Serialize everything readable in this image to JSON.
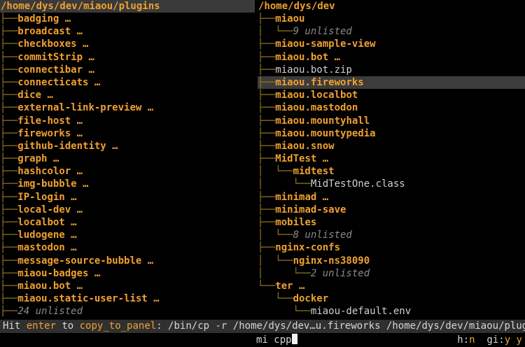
{
  "left_panel": {
    "path": "/home/dys/dev/miaou/plugins",
    "items": [
      {
        "name": "badging …",
        "kind": "dir"
      },
      {
        "name": "broadcast …",
        "kind": "dir"
      },
      {
        "name": "checkboxes …",
        "kind": "dir"
      },
      {
        "name": "commitStrip …",
        "kind": "dir"
      },
      {
        "name": "connectibar …",
        "kind": "dir"
      },
      {
        "name": "connecticats …",
        "kind": "dir"
      },
      {
        "name": "dice …",
        "kind": "dir"
      },
      {
        "name": "external-link-preview …",
        "kind": "dir"
      },
      {
        "name": "file-host …",
        "kind": "dir"
      },
      {
        "name": "fireworks …",
        "kind": "dir"
      },
      {
        "name": "github-identity …",
        "kind": "dir"
      },
      {
        "name": "graph …",
        "kind": "dir"
      },
      {
        "name": "hashcolor …",
        "kind": "dir"
      },
      {
        "name": "img-bubble …",
        "kind": "dir"
      },
      {
        "name": "IP-login …",
        "kind": "dir"
      },
      {
        "name": "local-dev …",
        "kind": "dir"
      },
      {
        "name": "localbot …",
        "kind": "dir"
      },
      {
        "name": "ludogene …",
        "kind": "dir"
      },
      {
        "name": "mastodon …",
        "kind": "dir"
      },
      {
        "name": "message-source-bubble …",
        "kind": "dir"
      },
      {
        "name": "miaou-badges …",
        "kind": "dir"
      },
      {
        "name": "miaou.bot …",
        "kind": "dir"
      },
      {
        "name": "miaou.static-user-list …",
        "kind": "dir"
      },
      {
        "name": "24 unlisted",
        "kind": "note"
      }
    ]
  },
  "right_panel": {
    "path": "/home/dys/dev",
    "items": [
      {
        "prefix": "├──",
        "name": "miaou",
        "kind": "dir"
      },
      {
        "prefix": "│  └──",
        "name": "9 unlisted",
        "kind": "note"
      },
      {
        "prefix": "├──",
        "name": "miaou-sample-view",
        "kind": "dir"
      },
      {
        "prefix": "├──",
        "name": "miaou.bot …",
        "kind": "dir"
      },
      {
        "prefix": "├──",
        "name": "miaou.bot.zip",
        "kind": "file"
      },
      {
        "prefix": "├──",
        "name": "miaou.fireworks",
        "kind": "dir",
        "selected": true
      },
      {
        "prefix": "├──",
        "name": "miaou.localbot",
        "kind": "dir"
      },
      {
        "prefix": "├──",
        "name": "miaou.mastodon",
        "kind": "dir"
      },
      {
        "prefix": "├──",
        "name": "miaou.mountyhall",
        "kind": "dir"
      },
      {
        "prefix": "├──",
        "name": "miaou.mountypedia",
        "kind": "dir"
      },
      {
        "prefix": "├──",
        "name": "miaou.snow",
        "kind": "dir"
      },
      {
        "prefix": "├──",
        "name": "MidTest …",
        "kind": "dir"
      },
      {
        "prefix": "│  └──",
        "name": "midtest",
        "kind": "dir"
      },
      {
        "prefix": "│     └──",
        "name": "MidTestOne.class",
        "kind": "file"
      },
      {
        "prefix": "├──",
        "name": "minimad …",
        "kind": "dir"
      },
      {
        "prefix": "├──",
        "name": "minimad-save",
        "kind": "dir"
      },
      {
        "prefix": "├──",
        "name": "mobiles",
        "kind": "dir"
      },
      {
        "prefix": "│  └──",
        "name": "8 unlisted",
        "kind": "note"
      },
      {
        "prefix": "├──",
        "name": "nginx-confs",
        "kind": "dir"
      },
      {
        "prefix": "│  └──",
        "name": "nginx-ns38090",
        "kind": "dir"
      },
      {
        "prefix": "│     └──",
        "name": "2 unlisted",
        "kind": "note"
      },
      {
        "prefix": "└──",
        "name": "ter …",
        "kind": "dir"
      },
      {
        "prefix": "   └──",
        "name": "docker",
        "kind": "dir"
      },
      {
        "prefix": "      └──",
        "name": "miaou-default.env",
        "kind": "file"
      }
    ]
  },
  "status": {
    "hit": "Hit",
    "key": "enter",
    "to": "to",
    "verb": "copy_to_panel",
    "command": ": /bin/cp -r /home/dys/dev…u.fireworks /home/dys/dev/miaou/plugins"
  },
  "input": {
    "command": "mi cpp",
    "flag_h_label": "h:",
    "flag_h_value": "n",
    "flag_gi_label": "gi:",
    "flag_gi_value": "y y"
  }
}
